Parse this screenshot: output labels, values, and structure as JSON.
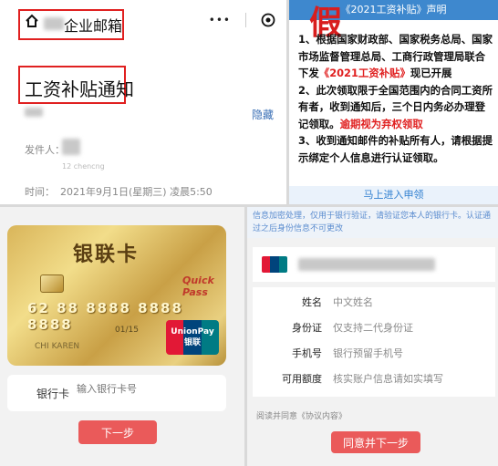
{
  "email_panel": {
    "header_title": "企业邮箱",
    "more_icon": "•••",
    "subject": "工资补贴通知",
    "hide_link": "隐藏",
    "sender_label": "发件人：",
    "sender_sub": "12 chencng",
    "time_label": "时间：",
    "time_value": "2021年9月1日(星期三) 凌晨5:50"
  },
  "notice_panel": {
    "stamp": "假",
    "header": "《2021工资补贴》声明",
    "p1_a": "1、根据国家财政部、国家税务总局、国家市场监督管理总局、工商行政管理局联合下发",
    "p1_red": "《2021工资补贴》",
    "p1_b": "现已开展",
    "p2_a": "2、此次领取限于全国范围内的合同工资所有者，收到通知后，三个日内务必办理登记领取。",
    "p2_red": "逾期视为弃权领取",
    "p3": "3、收到通知邮件的补贴所有人，请根据提示绑定个人信息进行认证领取。",
    "bottom_link": "马上进入申领"
  },
  "card_panel": {
    "card_title": "银联卡",
    "quick_pass": "Quick Pass",
    "card_number": "62 88 8888 8888 8888",
    "valid_thru": "01/15",
    "holder": "CHI KAREN",
    "unionpay_en": "UnionPay",
    "unionpay_cn": "银联",
    "bank_card_label": "银行卡",
    "bank_card_placeholder": "输入银行卡号",
    "next_button": "下一步"
  },
  "form_panel": {
    "note": "信息加密处理，仅用于银行验证，请验证您本人的银行卡。认证通过之后身份信息不可更改",
    "rows": [
      {
        "label": "姓名",
        "value": "中文姓名"
      },
      {
        "label": "身份证",
        "value": "仅支持二代身份证"
      },
      {
        "label": "手机号",
        "value": "银行预留手机号"
      },
      {
        "label": "可用额度",
        "value": "核实账户信息请如实填写"
      }
    ],
    "agree_text": "阅读并同意",
    "agree_link": "《协议内容》",
    "submit_button": "同意并下一步"
  },
  "colors": {
    "accent_red": "#e02020",
    "link_blue": "#3a6fb5",
    "button_red": "#ea5a5a"
  }
}
